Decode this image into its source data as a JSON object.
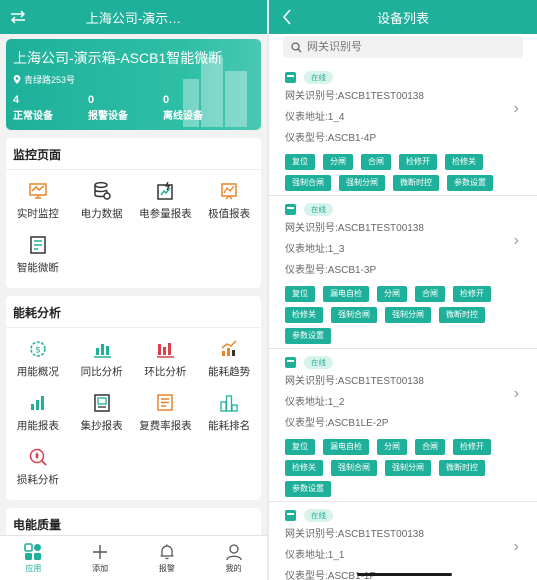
{
  "left": {
    "header": {
      "title": "上海公司-演示…",
      "switch_icon": "swap-icon"
    },
    "banner": {
      "title": "上海公司-演示箱-ASCB1智能微断",
      "address": "青绿路253号",
      "stats": [
        {
          "value": "4",
          "label": "正常设备"
        },
        {
          "value": "0",
          "label": "报警设备"
        },
        {
          "value": "0",
          "label": "离线设备"
        }
      ]
    },
    "sections": [
      {
        "title": "监控页面",
        "items": [
          {
            "label": "实时监控",
            "icon": "monitor-chart-icon"
          },
          {
            "label": "电力数据",
            "icon": "database-gear-icon"
          },
          {
            "label": "电参量报表",
            "icon": "power-report-icon"
          },
          {
            "label": "极值报表",
            "icon": "peak-report-icon"
          },
          {
            "label": "智能微断",
            "icon": "smart-breaker-icon"
          }
        ]
      },
      {
        "title": "能耗分析",
        "items": [
          {
            "label": "用能概况",
            "icon": "energy-overview-icon"
          },
          {
            "label": "同比分析",
            "icon": "yoy-chart-icon"
          },
          {
            "label": "环比分析",
            "icon": "mom-chart-icon"
          },
          {
            "label": "能耗趋势",
            "icon": "trend-chart-icon"
          },
          {
            "label": "用能报表",
            "icon": "energy-report-icon"
          },
          {
            "label": "集抄报表",
            "icon": "meter-reading-icon"
          },
          {
            "label": "复费率报表",
            "icon": "tariff-report-icon"
          },
          {
            "label": "能耗排名",
            "icon": "ranking-icon"
          },
          {
            "label": "损耗分析",
            "icon": "loss-analysis-icon"
          }
        ]
      },
      {
        "title": "电能质量",
        "items": [
          {
            "label": "",
            "icon": "waveform-icon"
          },
          {
            "label": "",
            "icon": "harmonics-icon"
          }
        ]
      }
    ],
    "tabs": [
      {
        "label": "应用",
        "icon": "apps-icon",
        "active": true
      },
      {
        "label": "添加",
        "icon": "plus-icon",
        "active": false
      },
      {
        "label": "报警",
        "icon": "bell-icon",
        "active": false
      },
      {
        "label": "我的",
        "icon": "user-icon",
        "active": false
      }
    ]
  },
  "right": {
    "header": {
      "title": "设备列表",
      "back_icon": "back-chevron-icon"
    },
    "search": {
      "placeholder": "网关识别号",
      "value": ""
    },
    "devices": [
      {
        "status": "在线",
        "gateway": "网关识别号:ASCB1TEST00138",
        "address": "仪表地址:1_4",
        "model": "仪表型号:ASCB1-4P",
        "buttons": [
          "复位",
          "分闸",
          "合闸",
          "检修开",
          "检修关",
          "强制合闸",
          "强制分闸",
          "微断时控",
          "参数设置"
        ]
      },
      {
        "status": "在线",
        "gateway": "网关识别号:ASCB1TEST00138",
        "address": "仪表地址:1_3",
        "model": "仪表型号:ASCB1-3P",
        "buttons": [
          "复位",
          "漏电自检",
          "分闸",
          "合闸",
          "检修开",
          "检修关",
          "强制合闸",
          "强制分闸",
          "微断时控",
          "参数设置"
        ]
      },
      {
        "status": "在线",
        "gateway": "网关识别号:ASCB1TEST00138",
        "address": "仪表地址:1_2",
        "model": "仪表型号:ASCB1LE-2P",
        "buttons": [
          "复位",
          "漏电自检",
          "分闸",
          "合闸",
          "检修开",
          "检修关",
          "强制合闸",
          "强制分闸",
          "微断时控",
          "参数设置"
        ]
      },
      {
        "status": "在线",
        "gateway": "网关识别号:ASCB1TEST00138",
        "address": "仪表地址:1_1",
        "model": "仪表型号:ASCB1-1P",
        "buttons": []
      }
    ]
  },
  "colors": {
    "accent": "#1eb09a",
    "icon_orange": "#e8852a",
    "icon_red": "#d9414f",
    "icon_dark": "#3a3a3a"
  }
}
